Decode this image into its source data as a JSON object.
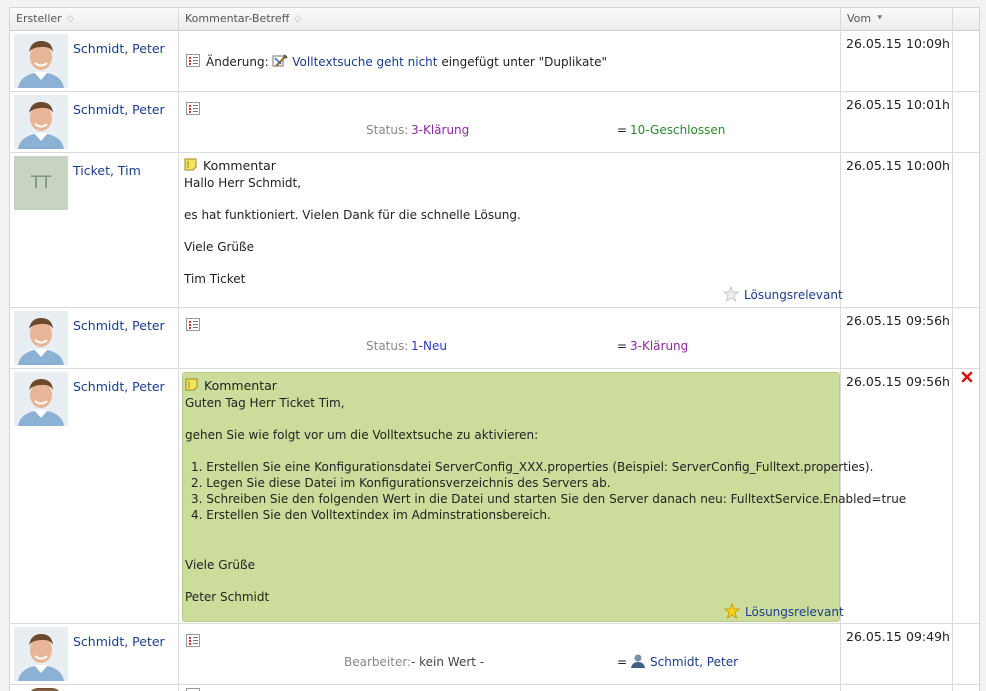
{
  "header": {
    "col_creator": "Ersteller",
    "col_subject": "Kommentar-Betreff",
    "col_date": "Vom"
  },
  "rows": [
    {
      "author": "Schmidt, Peter",
      "date": "26.05.15",
      "time": "10:09h",
      "change_prefix": "Änderung:",
      "change_link": "Volltextsuche geht nicht",
      "change_suffix": "eingefügt unter \"Duplikate\""
    },
    {
      "author": "Schmidt, Peter",
      "date": "26.05.15",
      "time": "10:01h",
      "field": "Status:",
      "old": "3-Klärung",
      "eq": "=",
      "new": "10-Geschlossen"
    },
    {
      "author": "Ticket, Tim",
      "initials": "TT",
      "date": "26.05.15",
      "time": "10:00h",
      "title": "Kommentar",
      "lines": [
        "Hallo Herr Schmidt,",
        "es hat funktioniert. Vielen Dank für die schnelle Lösung.",
        "Viele Grüße",
        "Tim Ticket"
      ],
      "flag": "Lösungsrelevant"
    },
    {
      "author": "Schmidt, Peter",
      "date": "26.05.15",
      "time": "09:56h",
      "field": "Status:",
      "old": "1-Neu",
      "eq": "=",
      "new": "3-Klärung"
    },
    {
      "author": "Schmidt, Peter",
      "date": "26.05.15",
      "time": "09:56h",
      "title": "Kommentar",
      "greeting": "Guten Tag Herr Ticket Tim,",
      "intro": "gehen Sie wie folgt vor um die Volltextsuche zu aktivieren:",
      "steps": [
        "1. Erstellen Sie eine Konfigurationsdatei ServerConfig_XXX.properties (Beispiel: ServerConfig_Fulltext.properties).",
        "2. Legen Sie diese Datei im Konfigurationsverzeichnis des Servers ab.",
        "3. Schreiben Sie den folgenden Wert in die Datei und starten Sie den Server danach neu: FulltextService.Enabled=true",
        "4. Erstellen Sie den Volltextindex im Adminstrationsbereich."
      ],
      "closing": "Viele Grüße",
      "signature": "Peter Schmidt",
      "flag": "Lösungsrelevant"
    },
    {
      "author": "Schmidt, Peter",
      "date": "26.05.15",
      "time": "09:49h",
      "field": "Bearbeiter:",
      "old": "- kein Wert -",
      "eq": "=",
      "new": "Schmidt, Peter"
    }
  ]
}
